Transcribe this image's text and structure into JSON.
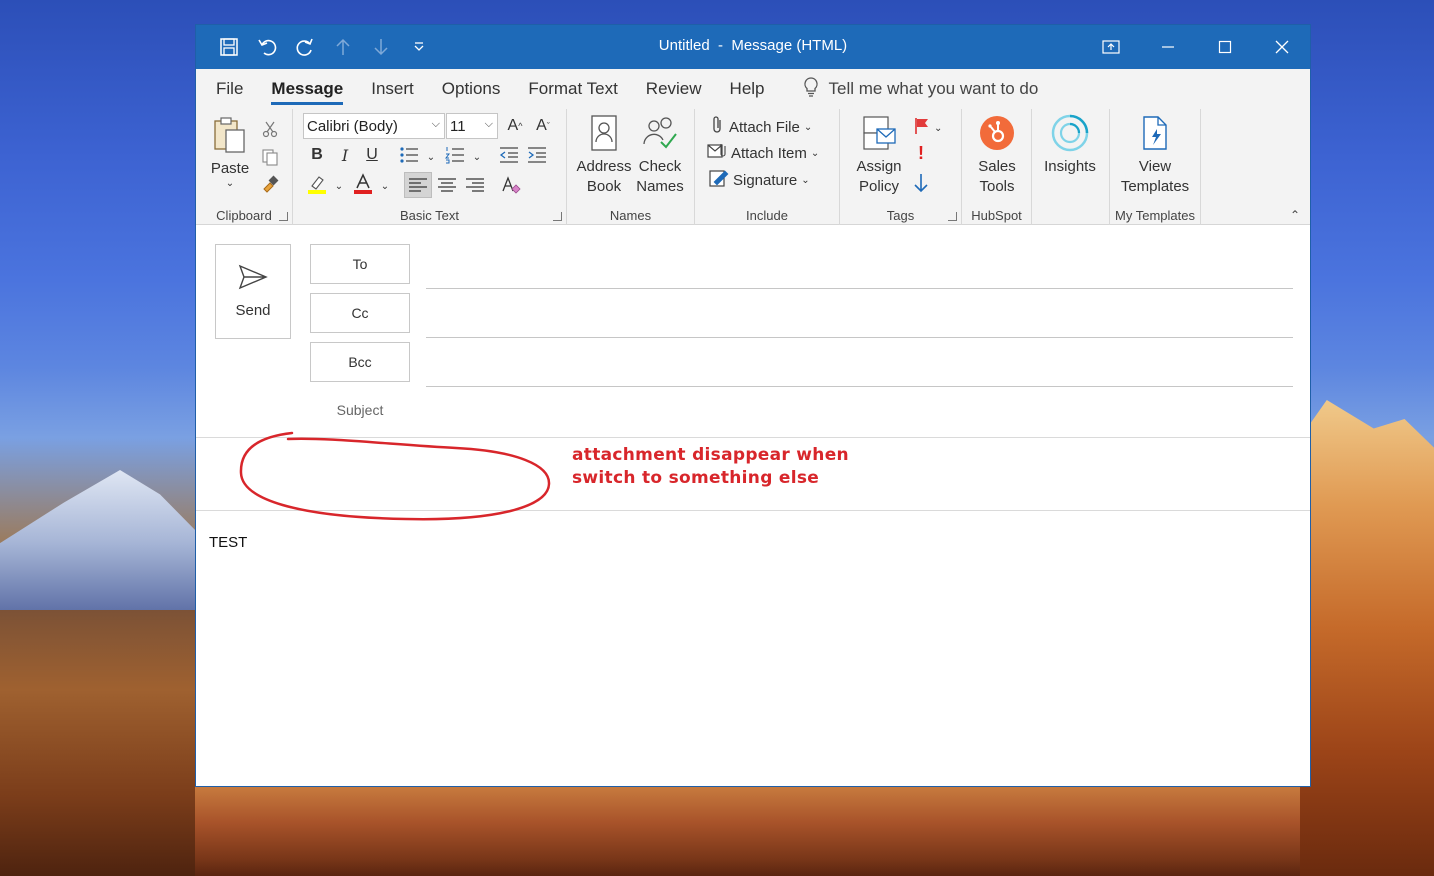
{
  "window": {
    "title": "Untitled  -  Message (HTML)",
    "accent": "#1e6ab8"
  },
  "quick_access": [
    {
      "icon": "save-icon"
    },
    {
      "icon": "undo-icon"
    },
    {
      "icon": "redo-icon"
    },
    {
      "icon": "arrow-up-icon"
    },
    {
      "icon": "arrow-down-icon"
    },
    {
      "icon": "customize-qat-icon"
    }
  ],
  "menu": {
    "items": [
      "File",
      "Message",
      "Insert",
      "Options",
      "Format Text",
      "Review",
      "Help"
    ],
    "active": "Message",
    "tell_me": "Tell me what you want to do"
  },
  "ribbon": {
    "clipboard": {
      "label": "Clipboard",
      "paste": "Paste"
    },
    "basic_text": {
      "label": "Basic Text",
      "font": "Calibri (Body)",
      "size": "11",
      "grow": "A",
      "shrink": "A",
      "bold": "B",
      "italic": "I",
      "underline": "U",
      "highlight_color": "#ffff00",
      "font_color": "#e02020"
    },
    "names": {
      "label": "Names",
      "address_book": "Address Book",
      "check_names": "Check Names"
    },
    "include": {
      "label": "Include",
      "attach_file": "Attach File",
      "attach_item": "Attach Item",
      "signature": "Signature"
    },
    "tags": {
      "label": "Tags",
      "assign_policy": "Assign Policy",
      "importance_high": "!"
    },
    "hubspot": {
      "label": "HubSpot",
      "sales_tools": "Sales Tools",
      "brand_color": "#f26b3a"
    },
    "insights": {
      "label": "Insights"
    },
    "my_templates": {
      "label": "My Templates",
      "view_templates": "View Templates"
    }
  },
  "compose": {
    "send": "Send",
    "to": "To",
    "cc": "Cc",
    "bcc": "Bcc",
    "subject": "Subject",
    "body": "TEST"
  },
  "annotation": {
    "line1": "attachment disappear when",
    "line2": "switch to something else",
    "color": "#d8262b"
  }
}
